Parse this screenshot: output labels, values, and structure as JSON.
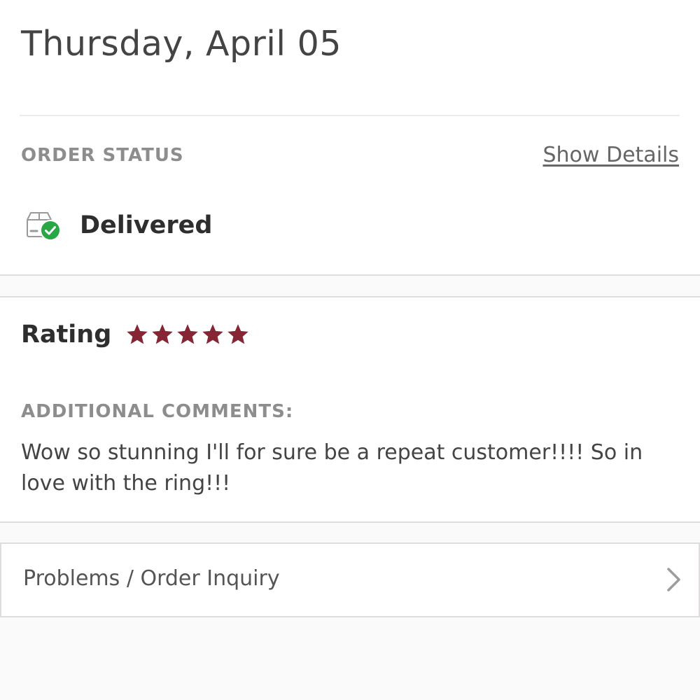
{
  "header": {
    "date": "Thursday, April 05"
  },
  "order_status": {
    "label": "ORDER STATUS",
    "show_details": "Show Details",
    "status_text": "Delivered",
    "status_icon": "package-delivered-icon",
    "status_color": "#29a745"
  },
  "rating": {
    "label": "Rating",
    "value": 5,
    "max": 5,
    "star_color": "#862634"
  },
  "comments": {
    "label": "ADDITIONAL COMMENTS:",
    "text": "Wow so stunning I'll for sure be a repeat customer!!!! So in love with the ring!!!"
  },
  "inquiry": {
    "label": "Problems / Order Inquiry",
    "icon": "chevron-right-icon"
  }
}
